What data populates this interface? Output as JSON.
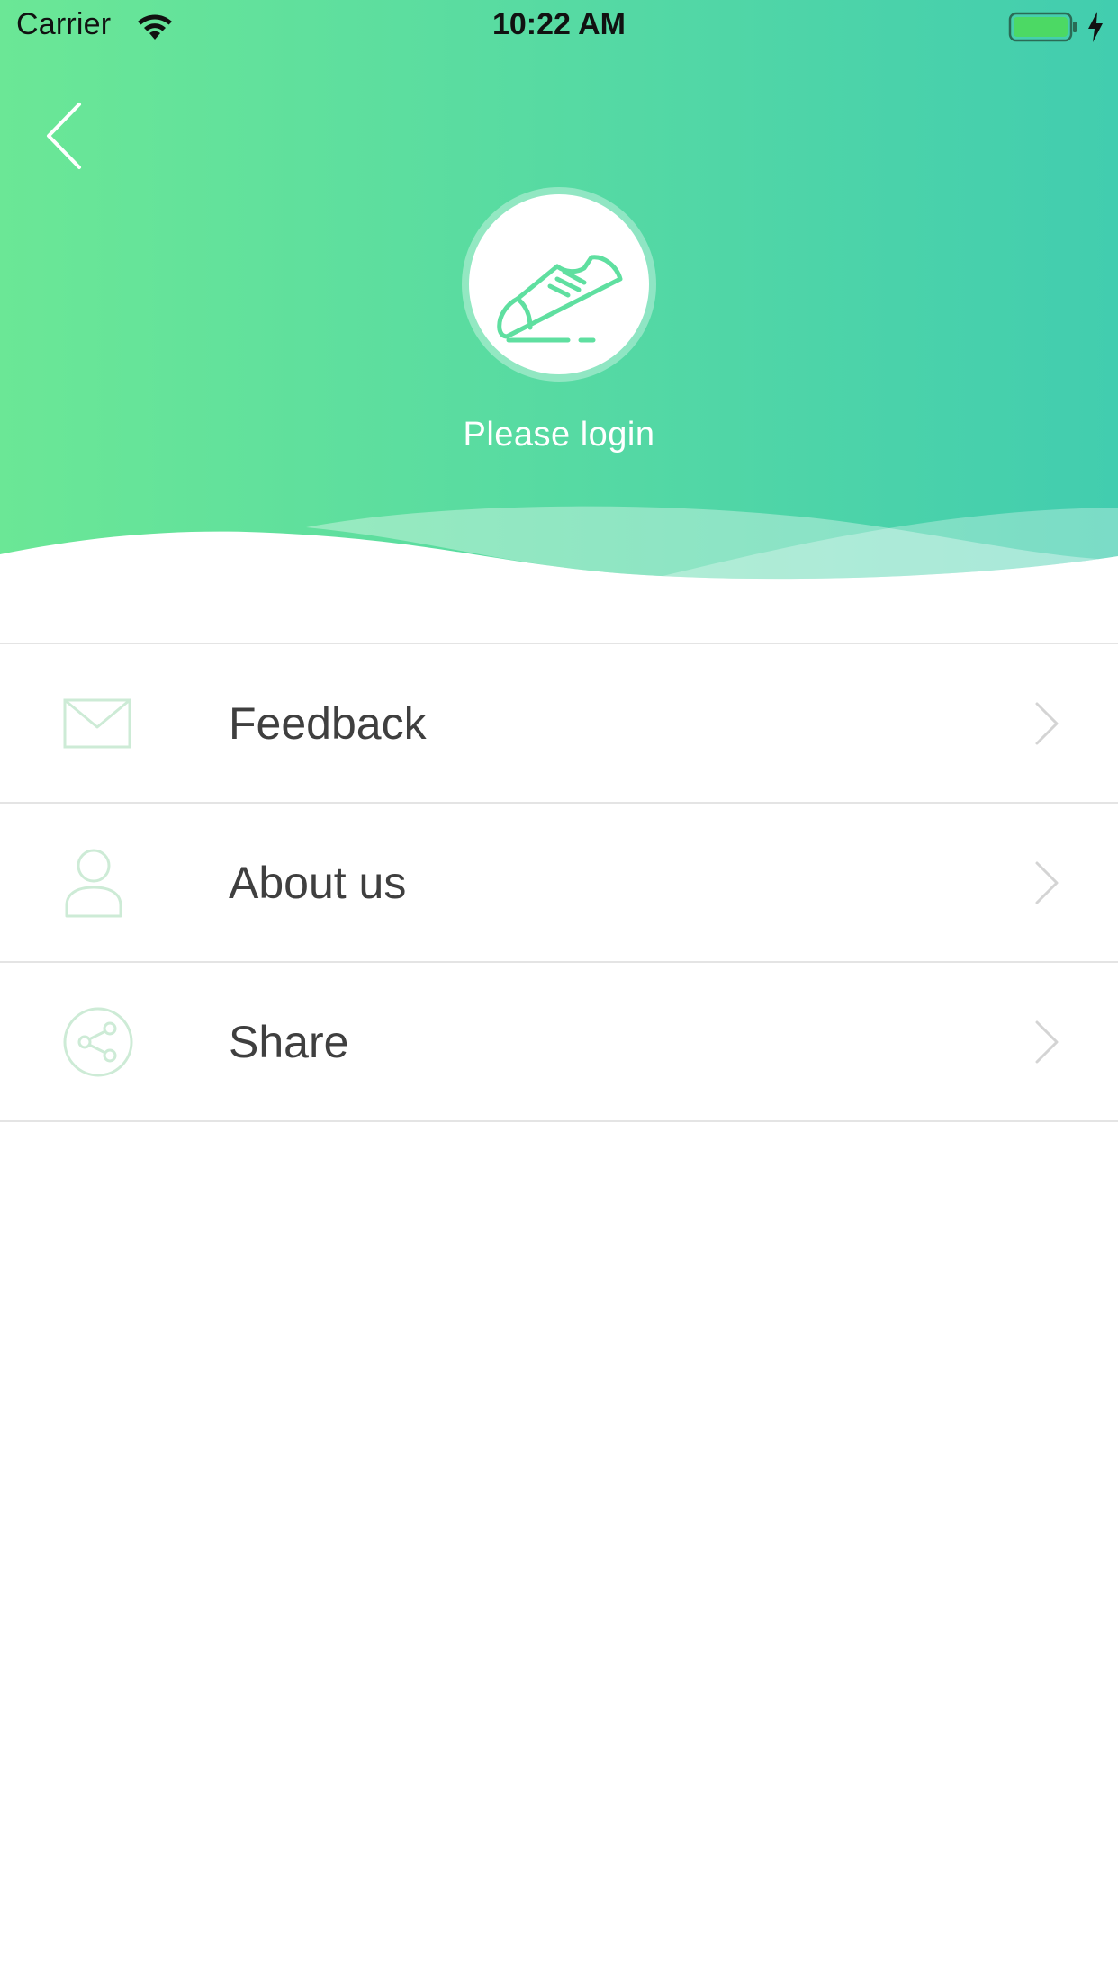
{
  "status_bar": {
    "carrier": "Carrier",
    "time": "10:22 AM",
    "wifi_icon": "wifi-icon",
    "battery_icon": "battery-icon",
    "charging_icon": "charging-bolt-icon"
  },
  "header": {
    "back_icon": "chevron-left-icon",
    "avatar_icon": "sneaker-icon",
    "login_label": "Please login",
    "gradient_start": "#6BE796",
    "gradient_end": "#42CDAF"
  },
  "menu": {
    "items": [
      {
        "label": "Feedback",
        "icon": "envelope-icon"
      },
      {
        "label": "About us",
        "icon": "person-icon"
      },
      {
        "label": "Share",
        "icon": "share-icon"
      }
    ],
    "icon_color": "#CDEBD6",
    "chevron_color": "#D4D4D4",
    "divider_color": "#E4E4E4"
  }
}
